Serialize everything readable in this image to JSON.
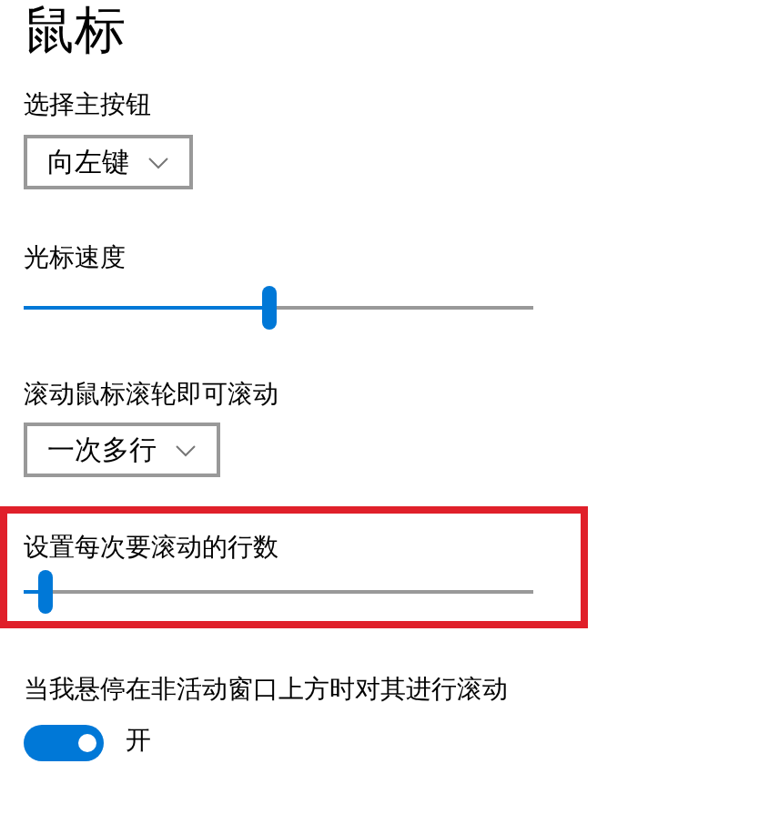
{
  "title": "鼠标",
  "primary_button": {
    "label": "选择主按钮",
    "value": "向左键"
  },
  "cursor_speed": {
    "label": "光标速度",
    "level": 0.48
  },
  "wheel_scroll": {
    "label": "滚动鼠标滚轮即可滚动",
    "value": "一次多行"
  },
  "lines_to_scroll": {
    "label": "设置每次要滚动的行数",
    "highlighted": true
  },
  "inactive_scroll": {
    "label": "当我悬停在非活动窗口上方时对其进行滚动",
    "on": true,
    "state_label": "开"
  }
}
